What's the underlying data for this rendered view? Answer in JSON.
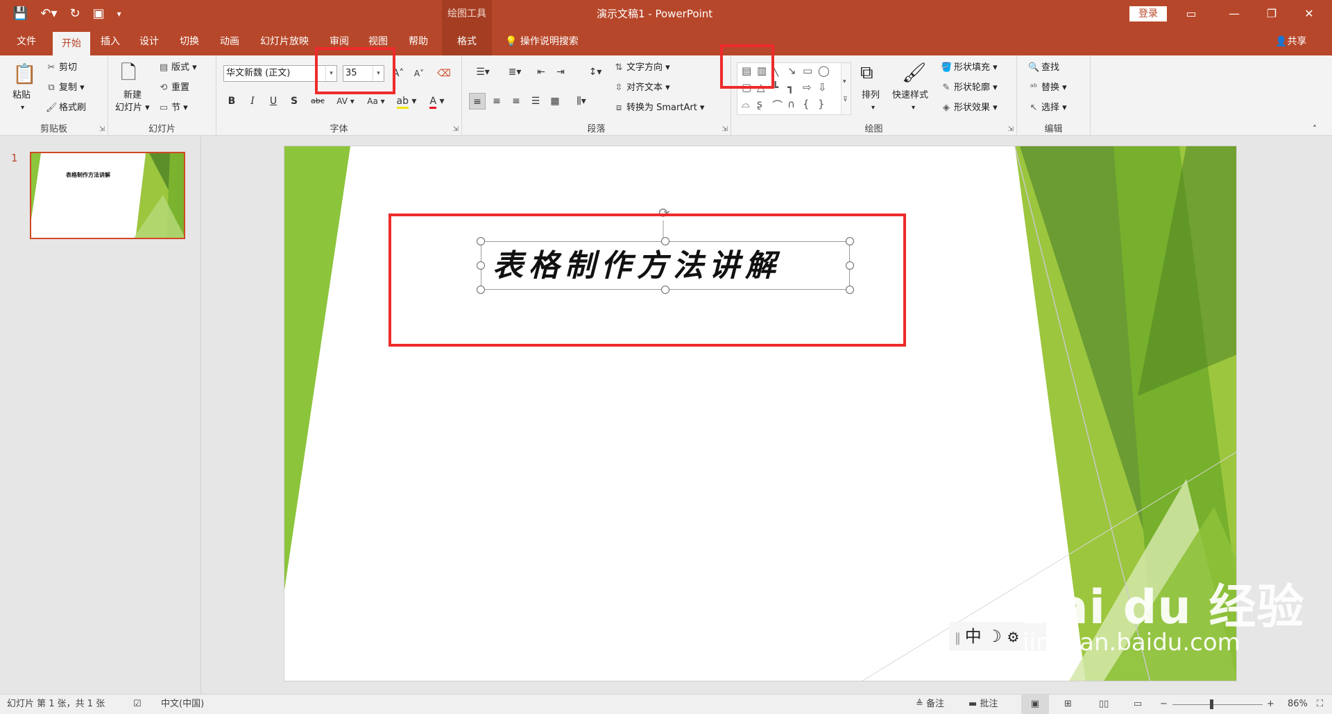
{
  "titlebar": {
    "context_tab": "绘图工具",
    "title": "演示文稿1  -  PowerPoint",
    "login": "登录",
    "qat_icons": [
      "save-icon",
      "undo-icon",
      "redo-icon",
      "start-slideshow-icon",
      "customize-qat-icon"
    ]
  },
  "tabs": [
    "文件",
    "开始",
    "插入",
    "设计",
    "切换",
    "动画",
    "幻灯片放映",
    "审阅",
    "视图",
    "帮助",
    "格式"
  ],
  "tell_me": "操作说明搜索",
  "share": "共享",
  "ribbon": {
    "clipboard": {
      "label": "剪贴板",
      "paste": "粘贴",
      "cut": "剪切",
      "copy": "复制",
      "format_painter": "格式刷"
    },
    "slides": {
      "label": "幻灯片",
      "new_slide_1": "新建",
      "new_slide_2": "幻灯片",
      "layout": "版式",
      "reset": "重置",
      "section": "节"
    },
    "font": {
      "label": "字体",
      "font_name": "华文新魏 (正文)",
      "font_size": "35",
      "bold": "B",
      "italic": "I",
      "underline": "U",
      "shadow": "S",
      "strike": "abc",
      "spacing": "AV",
      "case": "Aa",
      "grow": "A",
      "shrink": "A"
    },
    "paragraph": {
      "label": "段落",
      "text_direction": "文字方向",
      "align_text": "对齐文本",
      "smartart": "转换为 SmartArt"
    },
    "drawing": {
      "label": "绘图",
      "arrange": "排列",
      "quick_styles": "快速样式",
      "shape_fill": "形状填充",
      "shape_outline": "形状轮廓",
      "shape_effects": "形状效果"
    },
    "editing": {
      "label": "编辑",
      "find": "查找",
      "replace": "替换",
      "select": "选择"
    }
  },
  "thumbnail": {
    "number": "1",
    "title": "表格制作方法讲解"
  },
  "slide": {
    "title": "表格制作方法讲解"
  },
  "ime": {
    "mode": "中",
    "icons": [
      "moon-icon",
      "gear-icon"
    ]
  },
  "watermark": {
    "logo": "Bai du 经验",
    "url": "jingyan.baidu.com"
  },
  "statusbar": {
    "slide_info": "幻灯片 第 1 张，共 1 张",
    "language": "中文(中国)",
    "notes": "备注",
    "comments": "批注",
    "zoom": "86%",
    "zoom_level": 0.43
  },
  "colors": {
    "accent": "#b7472a",
    "context": "#a43d22",
    "highlight": "#ee2b2b",
    "green_dark": "#5c8f2a",
    "green_light": "#9cc63e"
  }
}
